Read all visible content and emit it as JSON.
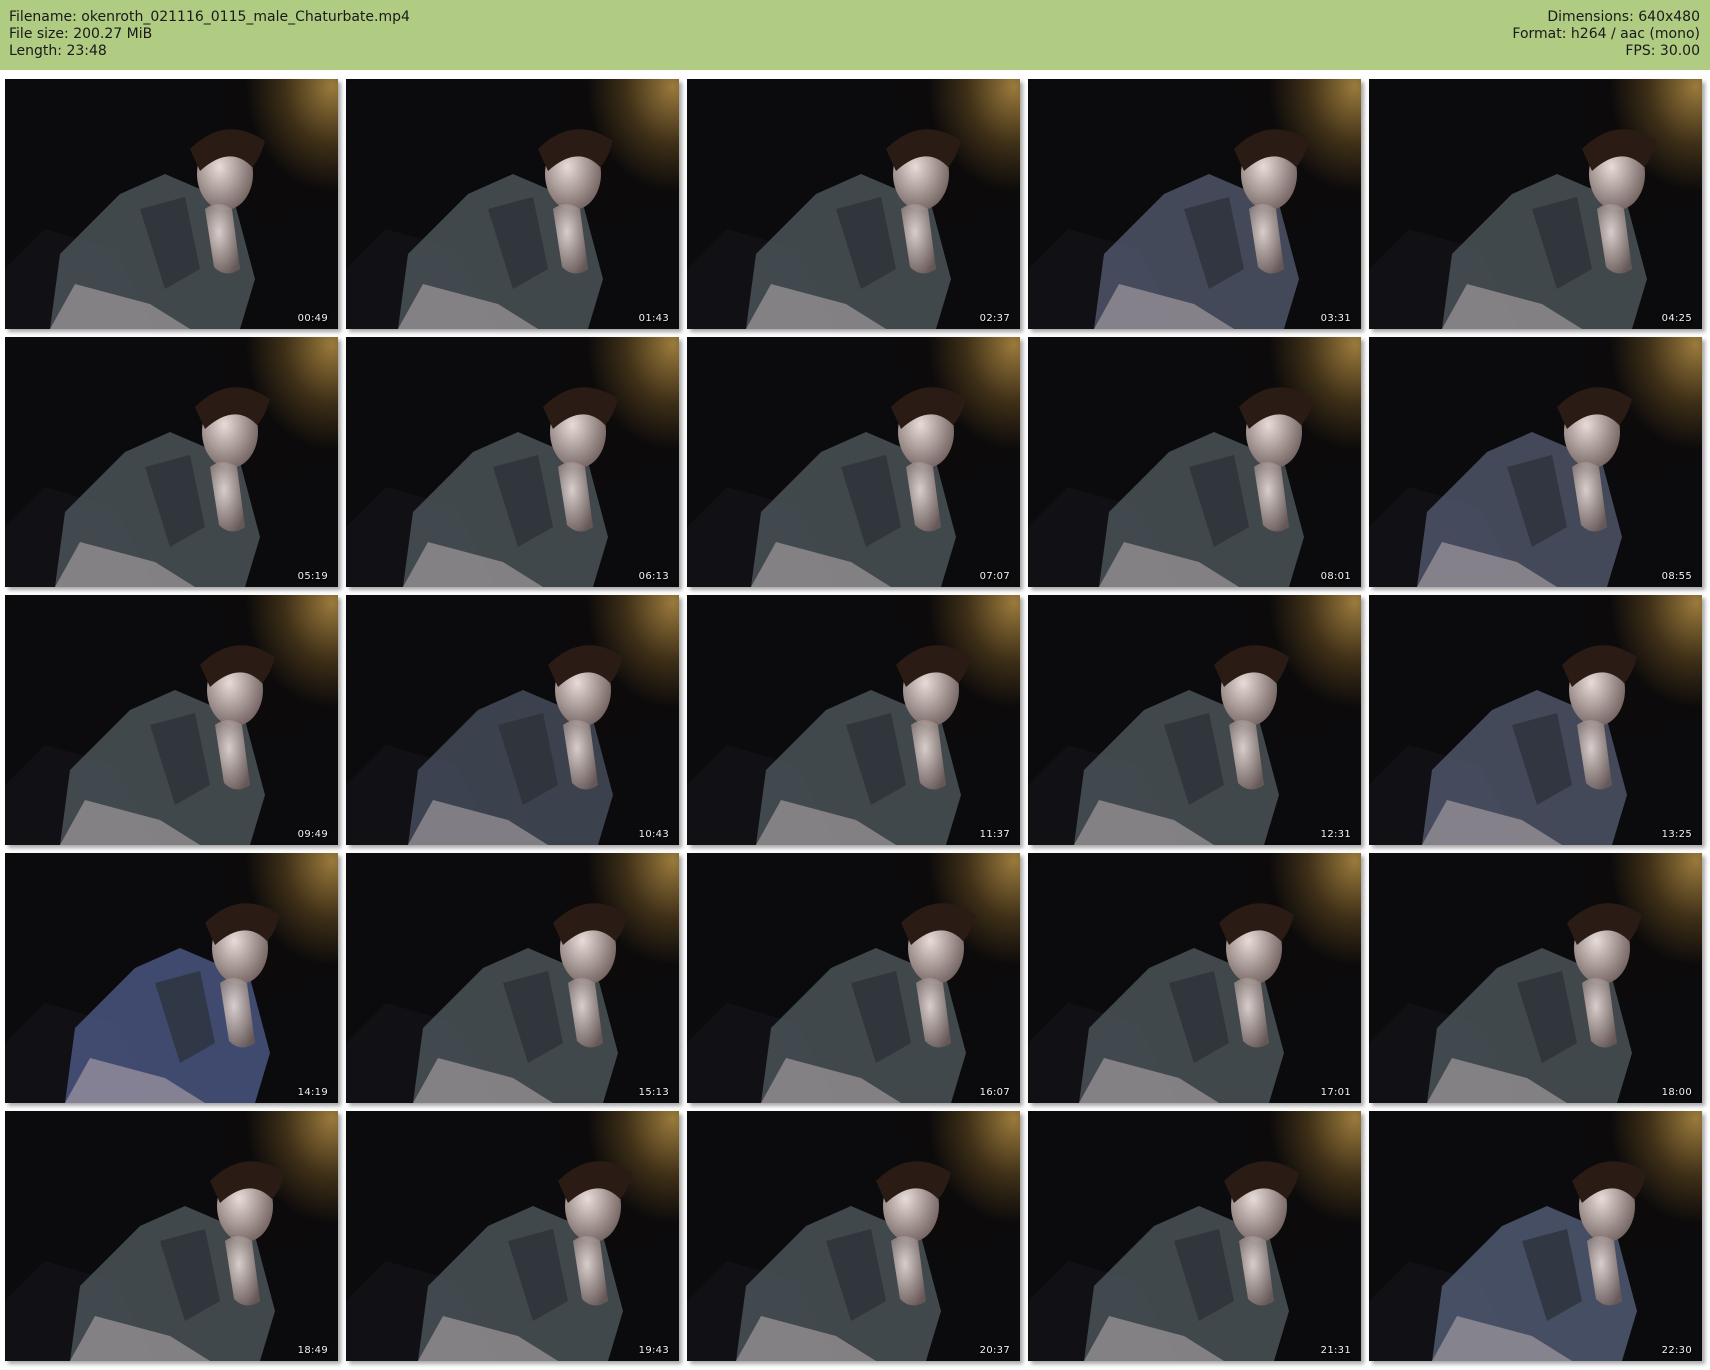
{
  "header": {
    "background": "#b0cb82",
    "filename": "Filename: okenroth_021116_0115_male_Chaturbate.mp4",
    "filesize": "File size: 200.27 MiB",
    "length": "Length: 23:48",
    "dimensions": "Dimensions: 640x480",
    "format": "Format: h264 / aac (mono)",
    "fps": "FPS: 30.00"
  },
  "thumbnails": [
    {
      "time": "00:49",
      "tint": "#4a5358"
    },
    {
      "time": "01:43",
      "tint": "#4a5358"
    },
    {
      "time": "02:37",
      "tint": "#4a5358"
    },
    {
      "time": "03:31",
      "tint": "#4f5568"
    },
    {
      "time": "04:25",
      "tint": "#4a5358"
    },
    {
      "time": "05:19",
      "tint": "#4a5358"
    },
    {
      "time": "06:13",
      "tint": "#4a5358"
    },
    {
      "time": "07:07",
      "tint": "#4a5358"
    },
    {
      "time": "08:01",
      "tint": "#4a5358"
    },
    {
      "time": "08:55",
      "tint": "#4f5568"
    },
    {
      "time": "09:49",
      "tint": "#4a5358"
    },
    {
      "time": "10:43",
      "tint": "#454b5a"
    },
    {
      "time": "11:37",
      "tint": "#4a5358"
    },
    {
      "time": "12:31",
      "tint": "#4a5358"
    },
    {
      "time": "13:25",
      "tint": "#4f5568"
    },
    {
      "time": "14:19",
      "tint": "#4a5680"
    },
    {
      "time": "15:13",
      "tint": "#4a5358"
    },
    {
      "time": "16:07",
      "tint": "#4a5358"
    },
    {
      "time": "17:01",
      "tint": "#4a5358"
    },
    {
      "time": "18:00",
      "tint": "#4a5358"
    },
    {
      "time": "18:49",
      "tint": "#4a5358"
    },
    {
      "time": "19:43",
      "tint": "#4a5358"
    },
    {
      "time": "20:37",
      "tint": "#4a5358"
    },
    {
      "time": "21:31",
      "tint": "#4a5358"
    },
    {
      "time": "22:30",
      "tint": "#505a72"
    }
  ]
}
